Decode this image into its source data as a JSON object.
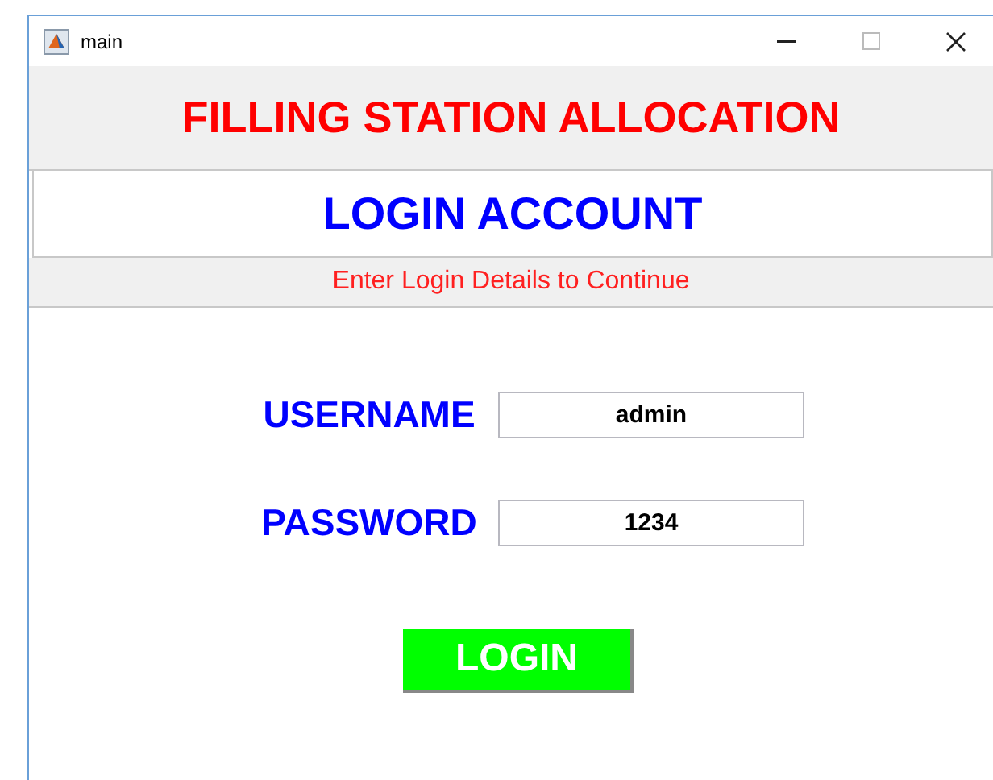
{
  "window": {
    "title": "main"
  },
  "header": {
    "title": "FILLING STATION ALLOCATION"
  },
  "panel": {
    "title": "LOGIN ACCOUNT",
    "subtitle": "Enter Login Details to Continue"
  },
  "fields": [
    {
      "label": "USERNAME",
      "value": "admin"
    },
    {
      "label": "PASSWORD",
      "value": "1234"
    }
  ],
  "buttons": [
    "LOGIN"
  ]
}
